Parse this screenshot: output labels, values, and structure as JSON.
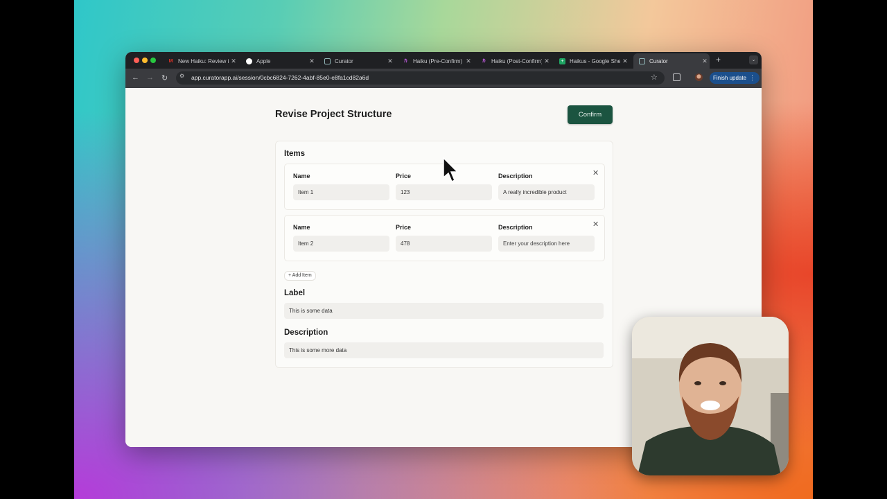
{
  "browser": {
    "tabs": [
      {
        "title": "New Haiku: Review i",
        "favicon": "gmail-icon",
        "color": "#d93025"
      },
      {
        "title": "Apple",
        "favicon": "apple-icon",
        "color": "#ffffff"
      },
      {
        "title": "Curator",
        "favicon": "curator-icon",
        "color": "#5f9ea0"
      },
      {
        "title": "Haiku (Pre-Confirm)",
        "favicon": "haiku-icon",
        "color": "#b04ad8"
      },
      {
        "title": "Haiku (Post-Confirm)",
        "favicon": "haiku-icon",
        "color": "#b04ad8"
      },
      {
        "title": "Haikus - Google She",
        "favicon": "sheets-icon",
        "color": "#1fa463"
      },
      {
        "title": "Curator",
        "favicon": "curator-icon",
        "color": "#5f9ea0",
        "active": true
      }
    ],
    "url": "app.curatorapp.ai/session/0cbc6824-7262-4abf-85e0-e8fa1cd82a6d",
    "finish_update_label": "Finish update"
  },
  "page": {
    "title": "Revise Project Structure",
    "confirm_label": "Confirm",
    "items_heading": "Items",
    "columns": {
      "name": "Name",
      "price": "Price",
      "description": "Description"
    },
    "items": [
      {
        "name": "Item 1",
        "price": "123",
        "description": "A really incredible product",
        "description_placeholder": "Enter your description here"
      },
      {
        "name": "Item 2",
        "price": "478",
        "description": "",
        "description_placeholder": "Enter your description here"
      }
    ],
    "add_item_label": "Add Item",
    "label_heading": "Label",
    "label_value": "This is some data",
    "description_heading": "Description",
    "description_value": "This is some more data"
  },
  "colors": {
    "confirm_button": "#1b5440",
    "finish_update_button": "#1b4f8c"
  }
}
